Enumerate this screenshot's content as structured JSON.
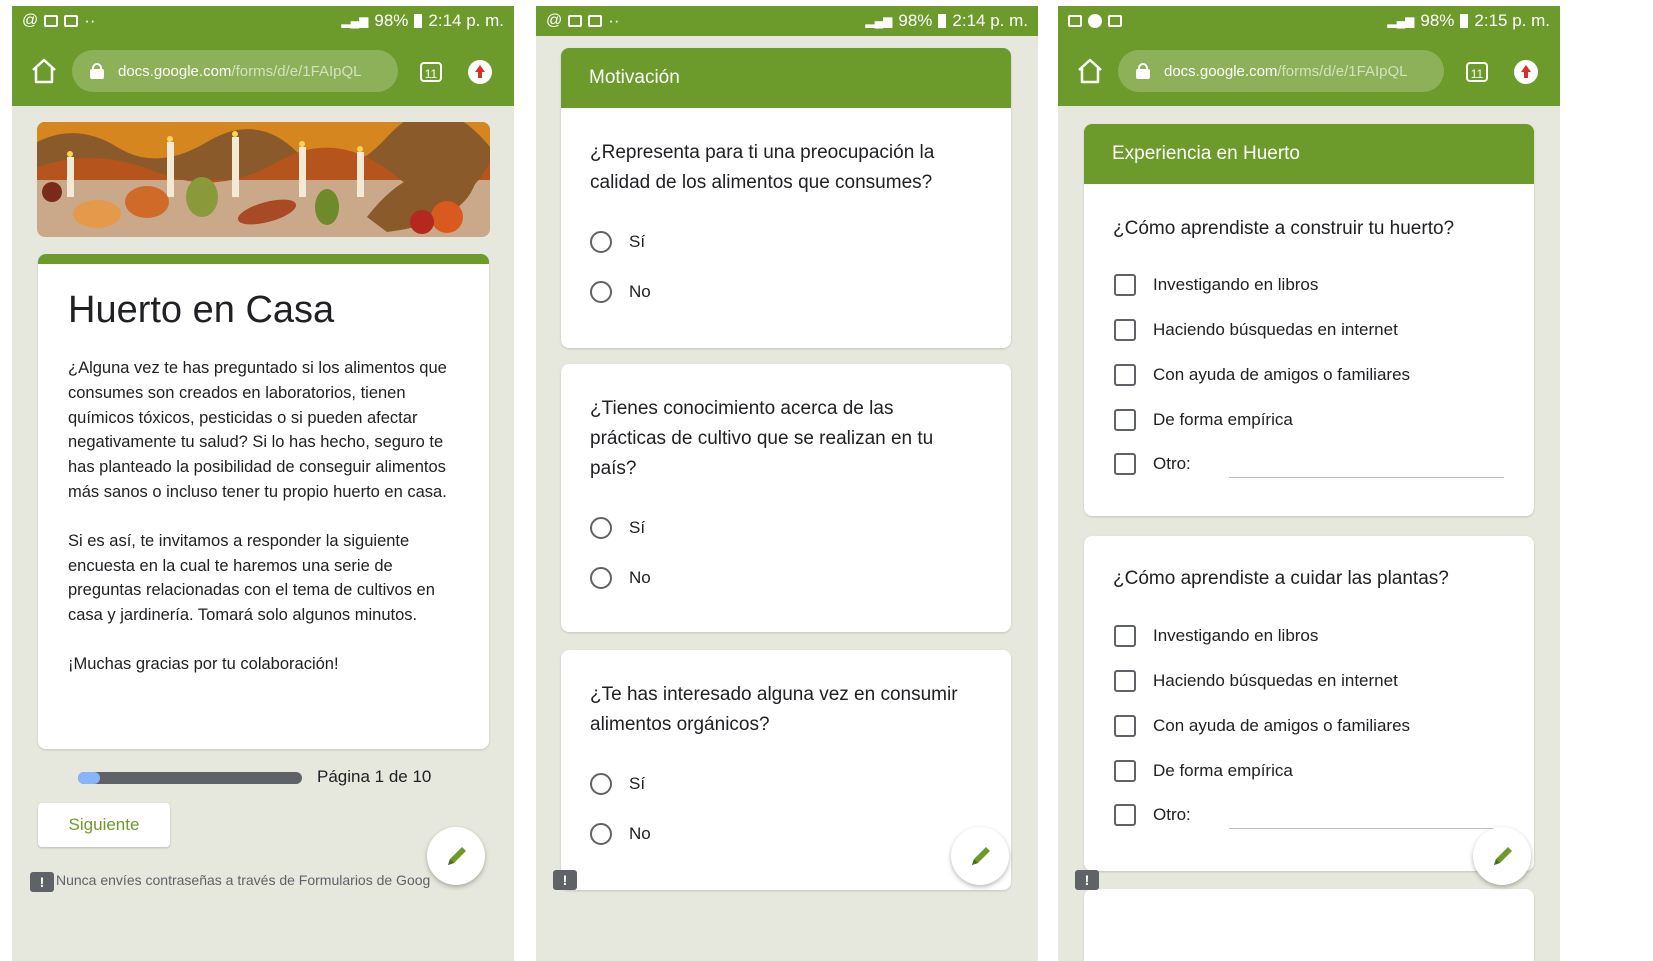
{
  "panel1": {
    "status": {
      "percent": "98%",
      "time": "2:14 p. m."
    },
    "url": {
      "host": "docs.google.com",
      "path": "/forms/d/e/1FAIpQL",
      "tabs": "11"
    },
    "form": {
      "title": "Huerto en Casa",
      "paragraph1": "¿Alguna vez te has preguntado si los alimentos que consumes son creados en laboratorios, tienen químicos tóxicos, pesticidas o si pueden afectar negativamente tu salud? Si lo has hecho, seguro te has planteado la posibilidad de conseguir alimentos más sanos o incluso tener tu propio huerto en casa.",
      "paragraph2": "Si es así, te invitamos a responder la siguiente encuesta en la cual te haremos una serie de preguntas relacionadas con el tema de cultivos en casa y jardinería. Tomará solo algunos minutos.",
      "paragraph3": "¡Muchas gracias por tu colaboración!"
    },
    "progress": {
      "label": "Página 1 de 10",
      "fraction": 0.1
    },
    "next_button": "Siguiente",
    "footer_warning": "Nunca envíes contraseñas a través de Formularios de Goog"
  },
  "panel2": {
    "status": {
      "percent": "98%",
      "time": "2:14 p. m."
    },
    "section_title": "Motivación",
    "questions": [
      {
        "text": "¿Representa para ti una preocupación la calidad de los alimentos que consumes?",
        "options": [
          "Sí",
          "No"
        ]
      },
      {
        "text": "¿Tienes conocimiento acerca de las prácticas de cultivo que se realizan en tu país?",
        "options": [
          "Sí",
          "No"
        ]
      },
      {
        "text": "¿Te has interesado alguna vez en consumir alimentos orgánicos?",
        "options": [
          "Sí",
          "No"
        ]
      }
    ]
  },
  "panel3": {
    "status": {
      "percent": "98%",
      "time": "2:15 p. m."
    },
    "url": {
      "host": "docs.google.com",
      "path": "/forms/d/e/1FAIpQL",
      "tabs": "11"
    },
    "section_title": "Experiencia en Huerto",
    "questions": [
      {
        "text": "¿Cómo aprendiste a construir tu huerto?",
        "options": [
          "Investigando en libros",
          "Haciendo búsquedas en internet",
          "Con ayuda de amigos o familiares",
          "De forma empírica",
          "Otro:"
        ]
      },
      {
        "text": "¿Cómo aprendiste a cuidar las plantas?",
        "options": [
          "Investigando en libros",
          "Haciendo búsquedas en internet",
          "Con ayuda de amigos o familiares",
          "De forma empírica",
          "Otro:"
        ]
      }
    ]
  },
  "colors": {
    "theme": "#6d9b2b",
    "background": "#e6e8dd",
    "progress_fill": "#8ab4f8",
    "progress_track": "#5f6368"
  },
  "icons": [
    "home-icon",
    "lock-icon",
    "tabs-icon",
    "update-icon",
    "pencil-icon",
    "feedback-icon",
    "radio-icon",
    "checkbox-icon"
  ]
}
